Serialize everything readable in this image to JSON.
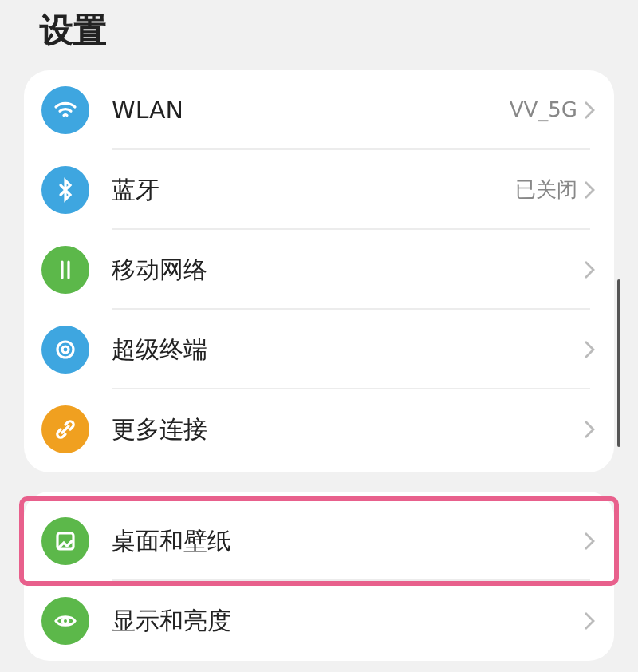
{
  "title": "设置",
  "groups": [
    {
      "items": [
        {
          "kind": "wifi",
          "label": "WLAN",
          "value": "VV_5G",
          "color": "#3ea6e0",
          "highlighted": false
        },
        {
          "kind": "bluetooth",
          "label": "蓝牙",
          "value": "已关闭",
          "color": "#3ea6e0",
          "highlighted": false
        },
        {
          "kind": "mobile",
          "label": "移动网络",
          "color": "#5cb84a",
          "highlighted": false
        },
        {
          "kind": "devices",
          "label": "超级终端",
          "color": "#3ea6e0",
          "highlighted": false
        },
        {
          "kind": "link",
          "label": "更多连接",
          "color": "#f0a020",
          "highlighted": false
        }
      ]
    },
    {
      "items": [
        {
          "kind": "wallpaper",
          "label": "桌面和壁纸",
          "color": "#5cb84a",
          "highlighted": true
        },
        {
          "kind": "display",
          "label": "显示和亮度",
          "color": "#5cb84a",
          "highlighted": false
        }
      ]
    }
  ]
}
